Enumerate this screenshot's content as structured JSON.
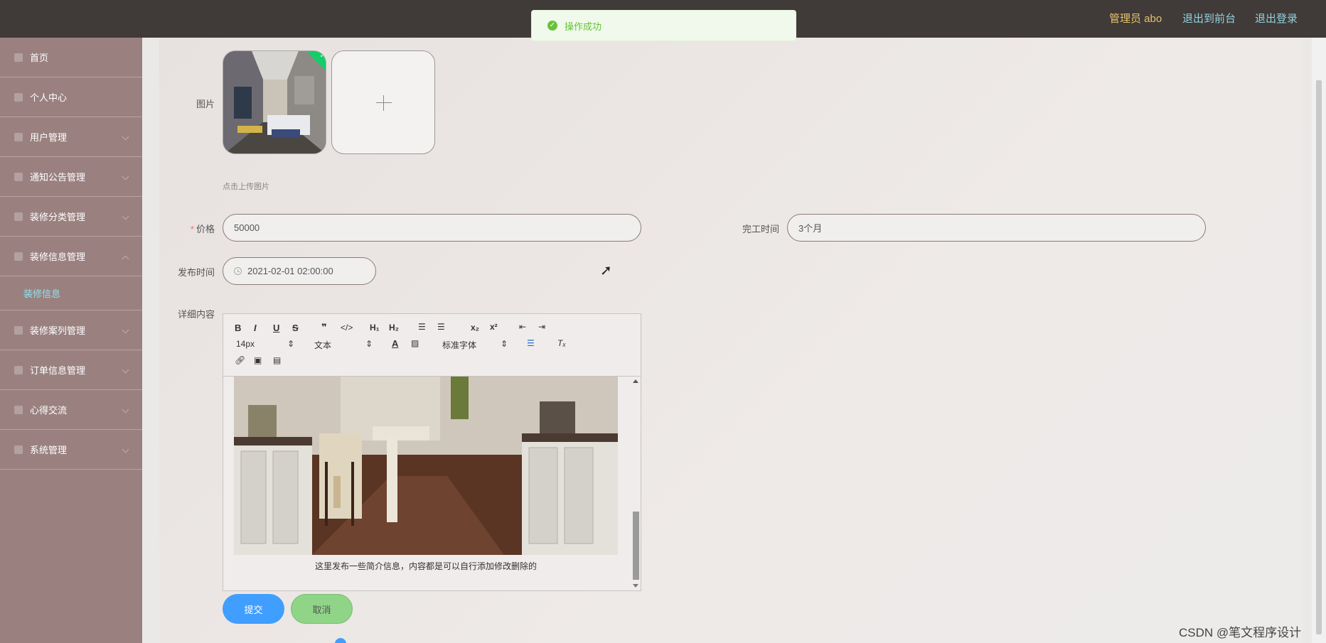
{
  "header": {
    "admin_label": "管理员 abo",
    "back_to_front": "退出到前台",
    "logout": "退出登录"
  },
  "toast": {
    "message": "操作成功",
    "icon": "success-check-icon"
  },
  "sidebar": {
    "items": [
      {
        "label": "首页",
        "icon": "home-icon"
      },
      {
        "label": "个人中心",
        "icon": "user-icon"
      },
      {
        "label": "用户管理",
        "icon": "monitor-icon"
      },
      {
        "label": "通知公告管理",
        "icon": "notice-icon"
      },
      {
        "label": "装修分类管理",
        "icon": "chart-icon"
      },
      {
        "label": "装修信息管理",
        "icon": "monitor-icon"
      },
      {
        "label": "装修案列管理",
        "icon": "list-icon"
      },
      {
        "label": "订单信息管理",
        "icon": "order-icon"
      },
      {
        "label": "心得交流",
        "icon": "chat-icon"
      },
      {
        "label": "系统管理",
        "icon": "settings-icon"
      }
    ],
    "active_sub": "装修信息"
  },
  "form": {
    "image_label": "图片",
    "upload_hint": "点击上传图片",
    "price_label": "价格",
    "price_value": "50000",
    "finish_label": "完工时间",
    "finish_value": "3个月",
    "publish_label": "发布时间",
    "publish_value": "2021-02-01 02:00:00",
    "detail_label": "详细内容"
  },
  "editor": {
    "font_size": "14px",
    "paragraph": "文本",
    "font_family": "标准字体",
    "caption": "这里发布一些简介信息，内容都是可以自行添加修改删除的"
  },
  "buttons": {
    "submit": "提交",
    "cancel": "取消"
  },
  "watermark": "CSDN @笔文程序设计"
}
